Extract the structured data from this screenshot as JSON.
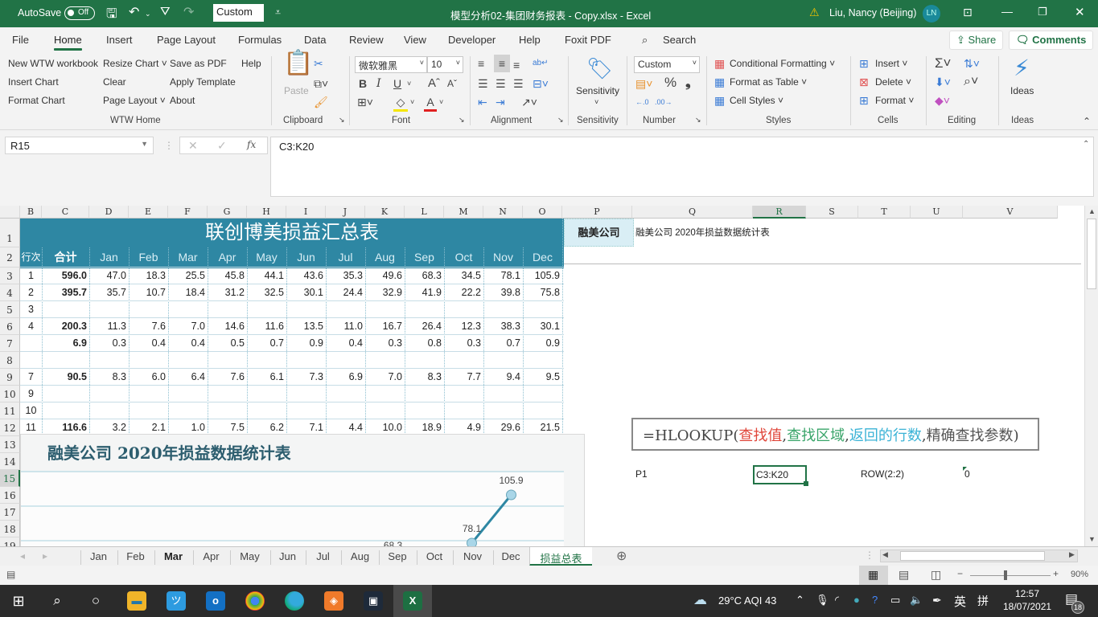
{
  "titlebar": {
    "autosave_label": "AutoSave",
    "autosave_state": "Off",
    "qat_style_value": "Custom",
    "doc_title": "模型分析02-集团财务报表 - Copy.xlsx  -  Excel",
    "user_name": "Liu, Nancy (Beijing)",
    "user_initials": "LN"
  },
  "ribbon_tabs": [
    "File",
    "Home",
    "Insert",
    "Page Layout",
    "Formulas",
    "Data",
    "Review",
    "View",
    "Developer",
    "Help",
    "Foxit PDF"
  ],
  "active_tab": "Home",
  "search_label": "Search",
  "share_label": "Share",
  "comments_label": "Comments",
  "wtw": {
    "items": [
      "New WTW workbook",
      "Insert Chart",
      "Format Chart",
      "Resize Chart",
      "Clear",
      "Page Layout",
      "Save as PDF",
      "Apply Template",
      "About",
      "Help"
    ],
    "group": "WTW Home"
  },
  "clipboard": {
    "paste": "Paste",
    "group": "Clipboard"
  },
  "font": {
    "name": "微软雅黑",
    "size": "10",
    "group": "Font"
  },
  "alignment": {
    "group": "Alignment"
  },
  "sensitivity": {
    "label": "Sensitivity",
    "group": "Sensitivity"
  },
  "number": {
    "format": "Custom",
    "group": "Number"
  },
  "styles": {
    "conditional": "Conditional Formatting",
    "format_table": "Format as Table",
    "cell_styles": "Cell Styles",
    "group": "Styles"
  },
  "cells": {
    "insert": "Insert",
    "delete": "Delete",
    "format": "Format",
    "group": "Cells"
  },
  "editing": {
    "group": "Editing"
  },
  "ideas": {
    "label": "Ideas",
    "group": "Ideas"
  },
  "formula_bar": {
    "name_box": "R15",
    "formula": "C3:K20"
  },
  "columns": [
    "B",
    "C",
    "D",
    "E",
    "F",
    "G",
    "H",
    "I",
    "J",
    "K",
    "L",
    "M",
    "N",
    "O",
    "P",
    "Q",
    "R",
    "S",
    "T",
    "U",
    "V"
  ],
  "rows": [
    "1",
    "2",
    "3",
    "4",
    "5",
    "6",
    "7",
    "8",
    "9",
    "10",
    "11",
    "12",
    "13",
    "14",
    "15",
    "16",
    "17",
    "18",
    "19"
  ],
  "selected_col": "R",
  "selected_row": "15",
  "table": {
    "title": "联创博美损益汇总表",
    "headers": [
      "行次",
      "合计",
      "Jan",
      "Feb",
      "Mar",
      "Apr",
      "May",
      "Jun",
      "Jul",
      "Aug",
      "Sep",
      "Oct",
      "Nov",
      "Dec"
    ],
    "rows": [
      [
        "1",
        "596.0",
        "47.0",
        "18.3",
        "25.5",
        "45.8",
        "44.1",
        "43.6",
        "35.3",
        "49.6",
        "68.3",
        "34.5",
        "78.1",
        "105.9"
      ],
      [
        "2",
        "395.7",
        "35.7",
        "10.7",
        "18.4",
        "31.2",
        "32.5",
        "30.1",
        "24.4",
        "32.9",
        "41.9",
        "22.2",
        "39.8",
        "75.8"
      ],
      [
        "3",
        "",
        "",
        "",
        "",
        "",
        "",
        "",
        "",
        "",
        "",
        "",
        "",
        ""
      ],
      [
        "4",
        "200.3",
        "11.3",
        "7.6",
        "7.0",
        "14.6",
        "11.6",
        "13.5",
        "11.0",
        "16.7",
        "26.4",
        "12.3",
        "38.3",
        "30.1"
      ],
      [
        "",
        "6.9",
        "0.3",
        "0.4",
        "0.4",
        "0.5",
        "0.7",
        "0.9",
        "0.4",
        "0.3",
        "0.8",
        "0.3",
        "0.7",
        "0.9"
      ],
      [
        "",
        "",
        "",
        "",
        "",
        "",
        "",
        "",
        "",
        "",
        "",
        "",
        "",
        ""
      ],
      [
        "7",
        "90.5",
        "8.3",
        "6.0",
        "6.4",
        "7.6",
        "6.1",
        "7.3",
        "6.9",
        "7.0",
        "8.3",
        "7.7",
        "9.4",
        "9.5"
      ],
      [
        "9",
        "",
        "",
        "",
        "",
        "",
        "",
        "",
        "",
        "",
        "",
        "",
        "",
        ""
      ],
      [
        "10",
        "",
        "",
        "",
        "",
        "",
        "",
        "",
        "",
        "",
        "",
        "",
        "",
        ""
      ],
      [
        "11",
        "116.6",
        "3.2",
        "2.1",
        "1.0",
        "7.5",
        "6.2",
        "7.1",
        "4.4",
        "10.0",
        "18.9",
        "4.9",
        "29.6",
        "21.5"
      ]
    ]
  },
  "side": {
    "p1_label": "融美公司",
    "q1_text": "融美公司  2020年损益数据统计表",
    "hlookup_prefix": "=HLOOKUP(",
    "hlookup_arg1": "查找值",
    "hlookup_arg2": "查找区域",
    "hlookup_arg3": "返回的行数",
    "hlookup_arg4": "精确查找参数",
    "hlookup_suffix": ")",
    "sep": ",",
    "p15": "P1",
    "r15": "C3:K20",
    "t15": "ROW(2:2)",
    "u15": "0",
    "colors": {
      "arg1": "#e0463a",
      "arg2": "#3aa56a",
      "arg3": "#3bb3d6",
      "arg4": "#555555"
    }
  },
  "chart_data": {
    "type": "line",
    "title": "融美公司  2020年损益数据统计表",
    "visible_points": [
      {
        "x": "Sep",
        "y": 68.3,
        "label": "68.3"
      },
      {
        "x": "Nov",
        "y": 78.1,
        "label": "78.1"
      },
      {
        "x": "Dec",
        "y": 105.9,
        "label": "105.9"
      }
    ],
    "color": "#2e87a3",
    "marker_fill": "#a9d6e8",
    "grid": true
  },
  "sheet_tabs": [
    "Jan",
    "Feb",
    "Mar",
    "Apr",
    "May",
    "Jun",
    "Jul",
    "Aug",
    "Sep",
    "Oct",
    "Nov",
    "Dec",
    "损益总表"
  ],
  "active_sheet": "损益总表",
  "status": {
    "zoom": "90%"
  },
  "taskbar": {
    "weather": "29°C  AQI 43",
    "ime1": "英",
    "ime2": "拼",
    "time": "12:57",
    "date": "18/07/2021",
    "notifications": "18"
  }
}
